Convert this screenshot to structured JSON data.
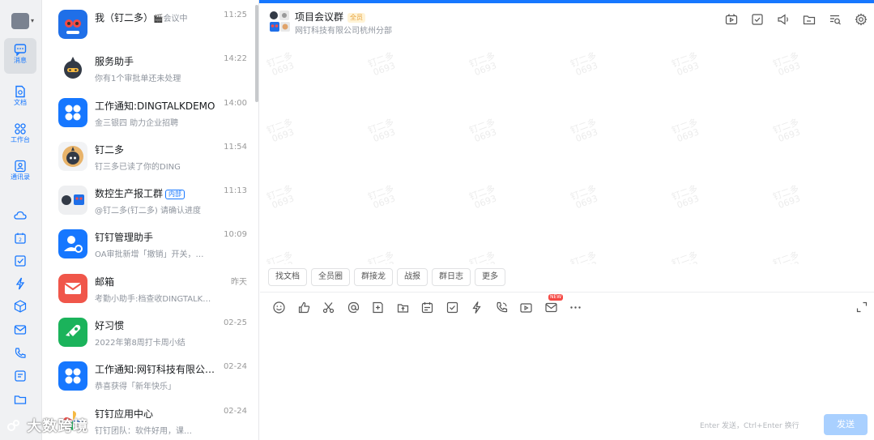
{
  "nav": {
    "items": [
      {
        "name": "message",
        "label": "消息"
      },
      {
        "name": "docs",
        "label": "文档"
      },
      {
        "name": "workbench",
        "label": "工作台"
      },
      {
        "name": "contacts",
        "label": "通讯录"
      }
    ],
    "accent": "#1677ff"
  },
  "conversations": [
    {
      "name": "我（钉二多）",
      "extra": "🎬会议中",
      "preview": "",
      "time": "11:25",
      "avatar": "robot-pair",
      "color": "#1f6fe8"
    },
    {
      "name": "服务助手",
      "preview": "你有1个审批单还未处理",
      "time": "14:22",
      "avatar": "robot-dark",
      "color": "#333a46"
    },
    {
      "name": "工作通知:DINGTALKDEMO",
      "preview": "金三银四 助力企业招聘",
      "time": "14:00",
      "avatar": "dots-icon",
      "color": "#1677ff"
    },
    {
      "name": "钉二多",
      "preview": "钉三多已读了你的DING",
      "time": "11:54",
      "avatar": "robot-gold",
      "color": "#333a46"
    },
    {
      "name": "数控生产报工群",
      "tag": "内部",
      "preview": "@钉二多(钉二多) 请确认进度",
      "time": "11:13",
      "avatar": "group",
      "color": "#e8e8e8"
    },
    {
      "name": "钉钉管理助手",
      "preview": "OA审批新增「撤销」开关，…",
      "time": "10:09",
      "avatar": "user-gear-icon",
      "color": "#1677ff"
    },
    {
      "name": "邮箱",
      "preview": "考勤小助手:档查收DINGTALK…",
      "time": "昨天",
      "avatar": "mail-icon",
      "color": "#f0564a"
    },
    {
      "name": "好习惯",
      "preview": "2022年第8周打卡周小结",
      "time": "02-25",
      "avatar": "rocket-icon",
      "color": "#1bb35b"
    },
    {
      "name": "工作通知:网钉科技有限公…",
      "preview": "恭喜获得「新年快乐」",
      "time": "02-24",
      "avatar": "dots-icon",
      "color": "#1677ff"
    },
    {
      "name": "钉钉应用中心",
      "preview": "钉钉团队：软件好用，课…",
      "time": "02-24",
      "avatar": "pinwheel",
      "color": "#fff"
    }
  ],
  "chat": {
    "title": "项目会议群",
    "badge": "全员",
    "subtitle": "网钉科技有限公司杭州分部",
    "watermark_text": "钉二多",
    "watermark_id": "0693"
  },
  "quick_actions": [
    "找文档",
    "全员圈",
    "群接龙",
    "战报",
    "群日志",
    "更多"
  ],
  "input": {
    "new_badge": "NEW",
    "hint": "Enter 发送，Ctrl+Enter 换行",
    "send_label": "发送"
  },
  "overlay_watermark": "大数跨境"
}
